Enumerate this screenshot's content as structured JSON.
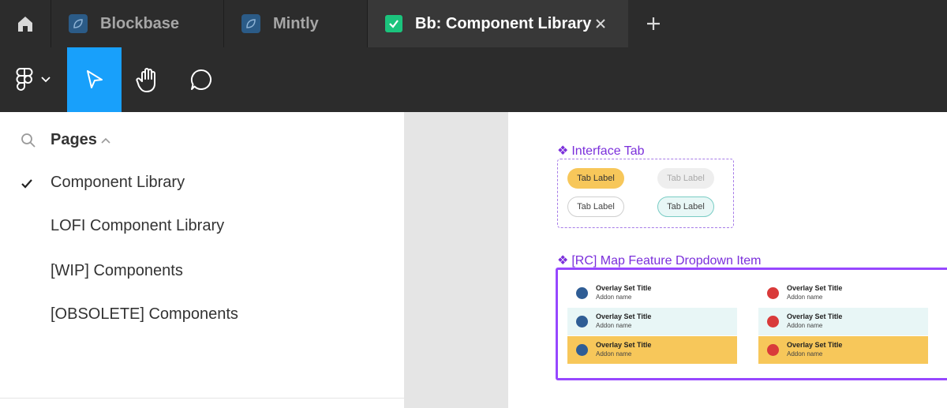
{
  "tabs": [
    {
      "label": "Blockbase"
    },
    {
      "label": "Mintly"
    },
    {
      "label": "Bb: Component Library"
    }
  ],
  "colors": {
    "accent": "#18a0fb",
    "chrome": "#2c2c2c",
    "purple": "#7b2fdb",
    "yellow": "#f7c75a"
  },
  "toolbar": {
    "icons": [
      "figma-logo-icon",
      "move-cursor-icon",
      "hand-icon",
      "comment-icon"
    ]
  },
  "pages": {
    "title": "Pages",
    "items": [
      {
        "label": "Component Library",
        "selected": true
      },
      {
        "label": "LOFI Component Library"
      },
      {
        "label": "[WIP] Components"
      },
      {
        "label": "[OBSOLETE] Components"
      }
    ]
  },
  "canvas": {
    "interface_tab": {
      "title": "Interface Tab",
      "pills": [
        "Tab Label",
        "Tab Label",
        "Tab Label",
        "Tab Label"
      ]
    },
    "map_feature": {
      "title": "[RC] Map Feature Dropdown Item",
      "rows": [
        {
          "title": "Overlay Set Title",
          "sub": "Addon name"
        },
        {
          "title": "Overlay Set Title",
          "sub": "Addon name"
        },
        {
          "title": "Overlay Set Title",
          "sub": "Addon name"
        },
        {
          "title": "Overlay Set Title",
          "sub": "Addon name"
        },
        {
          "title": "Overlay Set Title",
          "sub": "Addon name"
        },
        {
          "title": "Overlay Set Title",
          "sub": "Addon name"
        }
      ]
    }
  }
}
